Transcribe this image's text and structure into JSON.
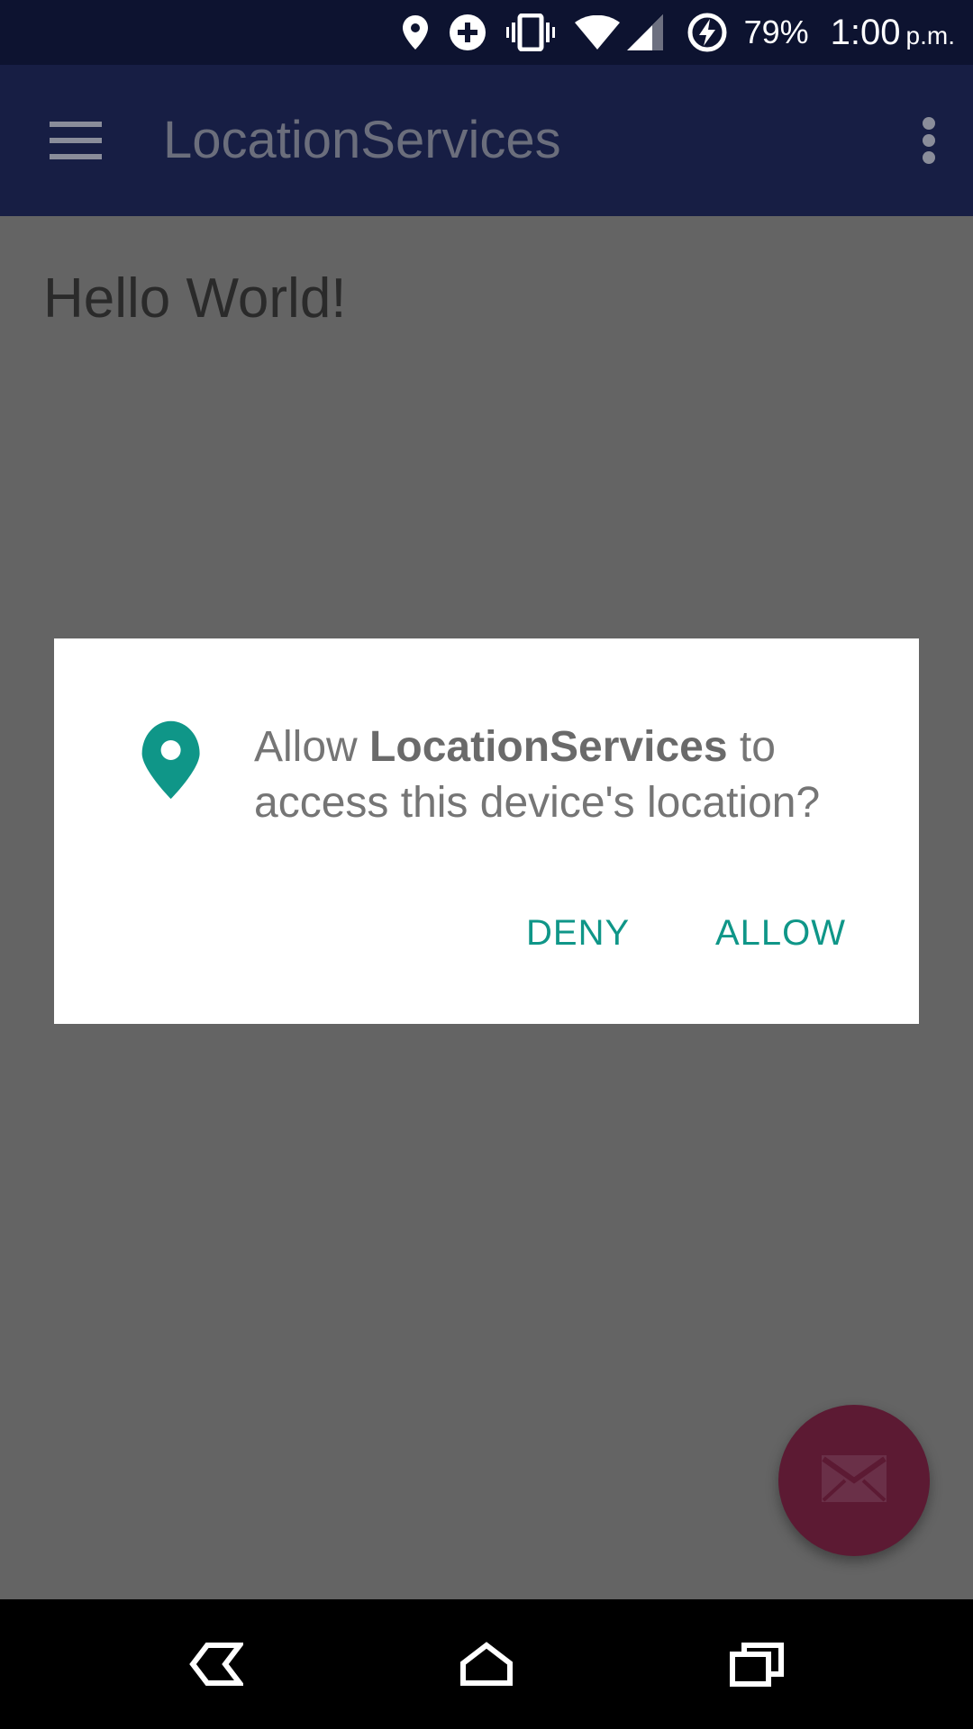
{
  "status_bar": {
    "battery_percent": "79%",
    "time": "1:00",
    "ampm": "p.m.",
    "icons": [
      "location-icon",
      "data-saver-icon",
      "vibrate-icon",
      "wifi-icon",
      "signal-icon",
      "battery-charging-icon"
    ]
  },
  "app_bar": {
    "title": "LocationServices",
    "menu_icon": "hamburger-menu-icon",
    "overflow_icon": "more-vert-icon"
  },
  "content": {
    "hello_text": "Hello World!"
  },
  "dialog": {
    "message_prefix": "Allow ",
    "message_app": "LocationServices",
    "message_suffix": " to access this device's location?",
    "deny_label": "DENY",
    "allow_label": "ALLOW",
    "icon": "location-pin-icon",
    "accent_color": "#0f9688"
  },
  "fab": {
    "icon": "mail-icon",
    "color": "#5c1a33"
  },
  "nav_bar": {
    "back_icon": "back-icon",
    "home_icon": "home-icon",
    "recents_icon": "recents-icon"
  },
  "colors": {
    "status_bar": "#0d1330",
    "app_bar": "#171e44",
    "scrim_background": "#646464"
  }
}
